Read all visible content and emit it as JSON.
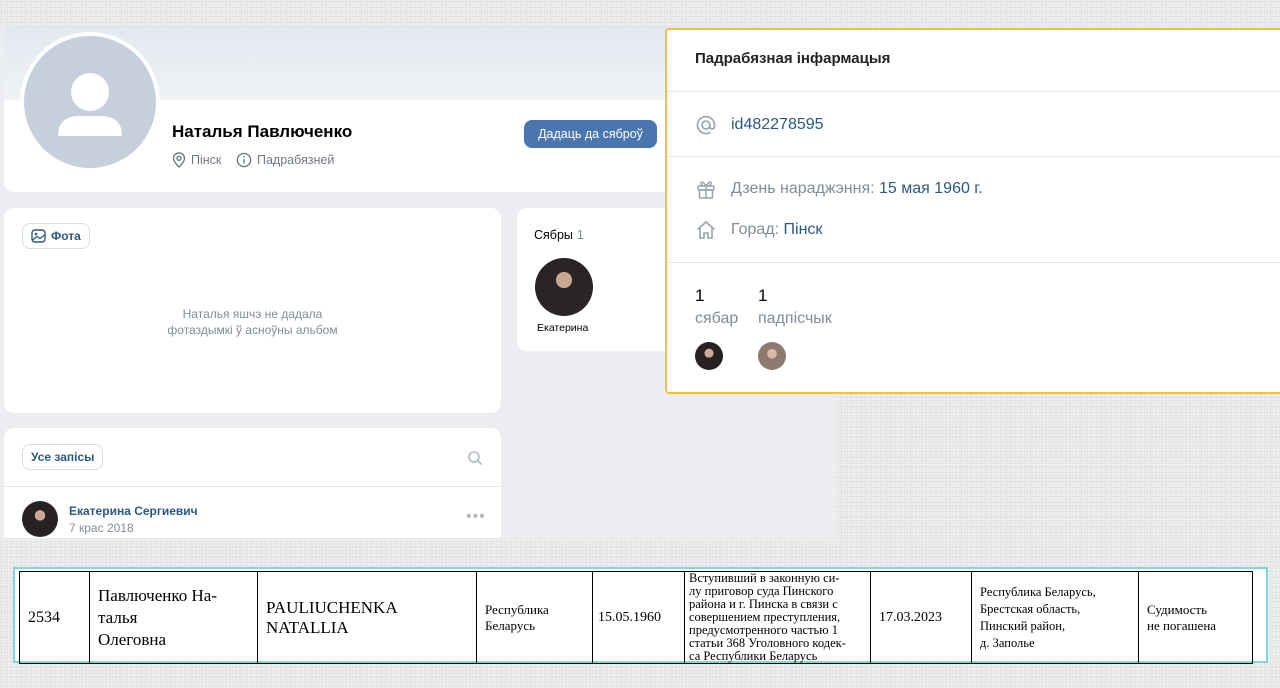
{
  "profile": {
    "name": "Наталья Павлюченко",
    "city": "Пінск",
    "more_link": "Падрабязней",
    "add_friend_button": "Дадаць да сяброў"
  },
  "photos": {
    "tab_label": "Фота",
    "empty_line1": "Наталья яшчэ не дадала",
    "empty_line2": "фотаздымкі ў асноўны альбом"
  },
  "friends": {
    "title": "Сябры",
    "count": "1",
    "friend_name": "Екатерина"
  },
  "posts": {
    "tab_label": "Усе запісы",
    "author": "Екатерина Сергиевич",
    "date": "7 крас 2018"
  },
  "details": {
    "title": "Падрабязная інфармацыя",
    "user_id": "id482278595",
    "birthday_label": "Дзень нараджэння:",
    "birthday_value": "15 мая 1960 г.",
    "city_label": "Горад:",
    "city_value": "Пінск",
    "friends_count": "1",
    "friends_label": "сябар",
    "followers_count": "1",
    "followers_label": "падпісчык"
  },
  "registry_row": {
    "number": "2534",
    "name_ru_line1": "Павлюченко На-",
    "name_ru_line2": "талья",
    "name_ru_line3": "Олеговна",
    "name_lat_line1": "PAULIUCHENKA",
    "name_lat_line2": "NATALLIA",
    "citizenship_line1": "Республика",
    "citizenship_line2": "Беларусь",
    "birth_date": "15.05.1960",
    "verdict_lines": [
      "Вступивший в законную си-",
      "лу приговор суда Пинского",
      "района и г. Пинска в связи с",
      "совершением преступления,",
      "предусмотренного частью 1",
      "статьи 368 Уголовного кодек-",
      "са Республики Беларусь"
    ],
    "decision_date": "17.03.2023",
    "address_line1": "Республика Беларусь,",
    "address_line2": "Брестская область,",
    "address_line3": "Пинский район,",
    "address_line4": "д. Заполье",
    "status_line1": "Судимость",
    "status_line2": "не погашена"
  },
  "colors": {
    "accent": "#4a76b0",
    "link": "#2a5885",
    "muted": "#818c99",
    "highlight_border": "#f0c23b",
    "table_frame": "#7fd6dc"
  }
}
